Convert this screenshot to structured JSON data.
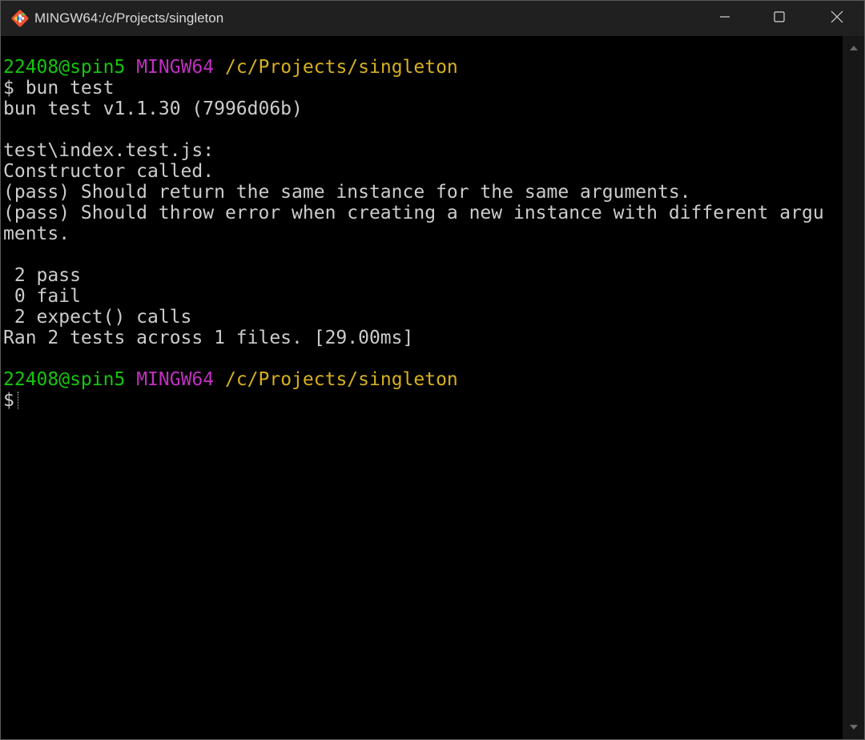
{
  "window": {
    "title": "MINGW64:/c/Projects/singleton",
    "icon": "git-bash-icon",
    "controls": {
      "minimize": "minimize-icon",
      "maximize": "maximize-icon",
      "close": "close-icon"
    }
  },
  "colors": {
    "background": "#000000",
    "text": "#cccccc",
    "user_host": "#16c60c",
    "shell_name": "#c030c0",
    "path": "#d6b021",
    "titlebar": "#202020"
  },
  "terminal": {
    "prompt1": {
      "user_host": "22408@spin5",
      "shell": "MINGW64",
      "path": "/c/Projects/singleton"
    },
    "command_line": "$ bun test",
    "lines": [
      "bun test v1.1.30 (7996d06b)",
      "",
      "test\\index.test.js:",
      "Constructor called.",
      "(pass) Should return the same instance for the same arguments.",
      "(pass) Should throw error when creating a new instance with different argu",
      "ments.",
      "",
      " 2 pass",
      " 0 fail",
      " 2 expect() calls",
      "Ran 2 tests across 1 files. [29.00ms]",
      ""
    ],
    "prompt2": {
      "user_host": "22408@spin5",
      "shell": "MINGW64",
      "path": "/c/Projects/singleton"
    },
    "input_prompt": "$"
  }
}
